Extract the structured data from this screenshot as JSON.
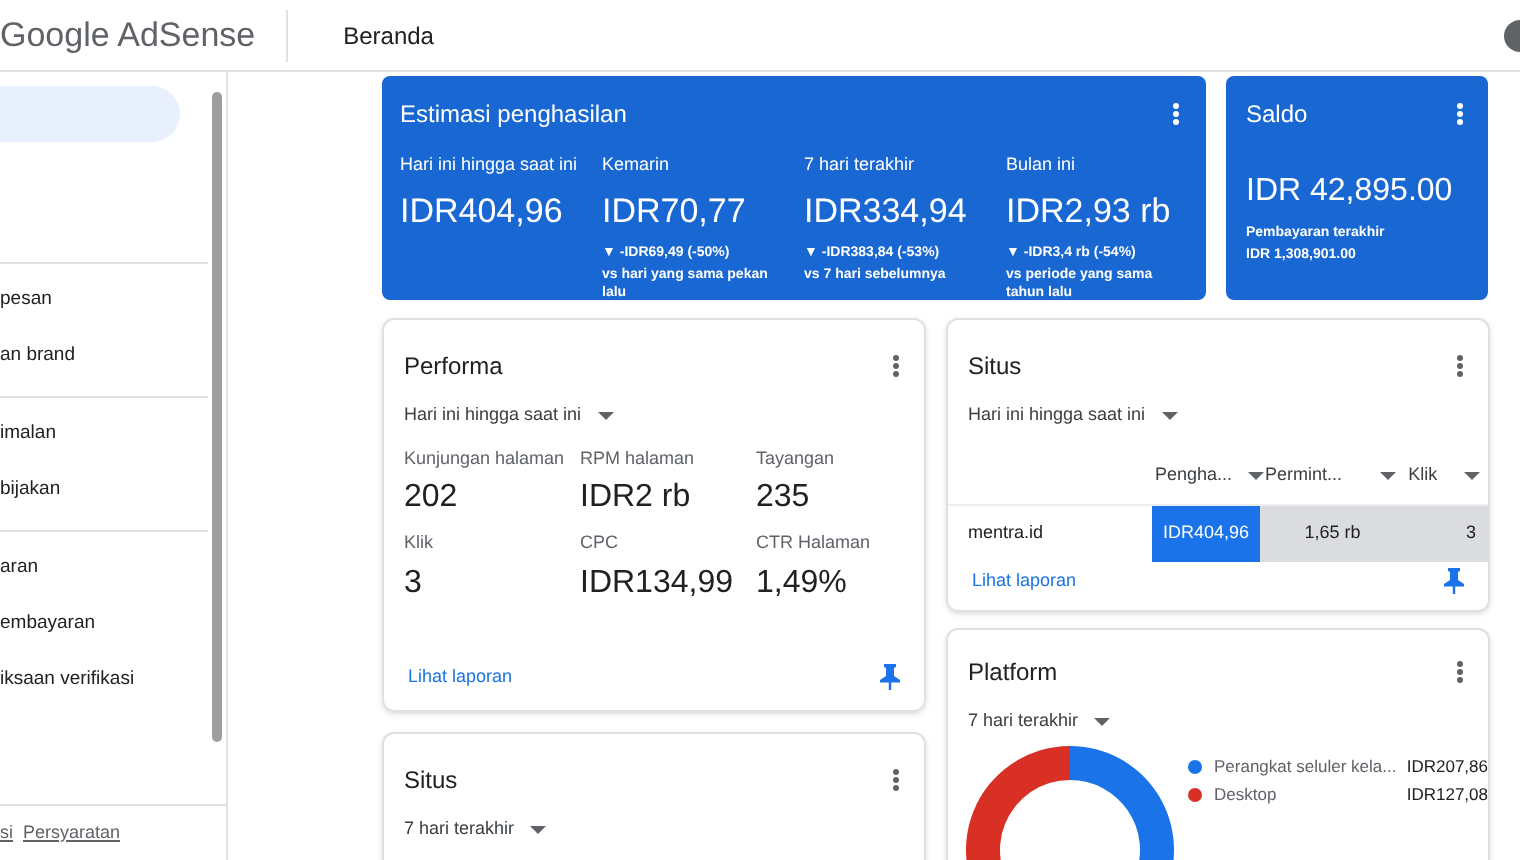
{
  "header": {
    "logo": "Google AdSense",
    "page_title": "Beranda"
  },
  "sidebar": {
    "groups": [
      {
        "items": [
          {
            "label": "pesan"
          },
          {
            "label": "an brand"
          }
        ]
      },
      {
        "items": [
          {
            "label": "imalan"
          },
          {
            "label": "bijakan"
          }
        ]
      },
      {
        "items": [
          {
            "label": "aran"
          },
          {
            "label": "embayaran"
          },
          {
            "label": "iksaan verifikasi"
          }
        ]
      }
    ],
    "footer_links": [
      "si",
      "Persyaratan"
    ]
  },
  "earnings": {
    "title": "Estimasi penghasilan",
    "metrics": [
      {
        "label": "Hari ini hingga saat ini",
        "value": "IDR404,96"
      },
      {
        "label": "Kemarin",
        "value": "IDR70,77",
        "change": "▼ -IDR69,49 (-50%)",
        "comparison": "vs hari yang sama pekan lalu"
      },
      {
        "label": "7 hari terakhir",
        "value": "IDR334,94",
        "change": "▼ -IDR383,84 (-53%)",
        "comparison": "vs 7 hari sebelumnya"
      },
      {
        "label": "Bulan ini",
        "value": "IDR2,93 rb",
        "change": "▼ -IDR3,4 rb (-54%)",
        "comparison": "vs periode yang sama tahun lalu"
      }
    ]
  },
  "balance": {
    "title": "Saldo",
    "value": "IDR 42,895.00",
    "last_payment_label": "Pembayaran terakhir",
    "last_payment_value": "IDR 1,308,901.00"
  },
  "performance": {
    "title": "Performa",
    "period": "Hari ini hingga saat ini",
    "metrics": [
      {
        "label": "Kunjungan halaman",
        "value": "202"
      },
      {
        "label": "RPM halaman",
        "value": "IDR2 rb"
      },
      {
        "label": "Tayangan",
        "value": "235"
      },
      {
        "label": "Klik",
        "value": "3"
      },
      {
        "label": "CPC",
        "value": "IDR134,99"
      },
      {
        "label": "CTR Halaman",
        "value": "1,49%"
      }
    ],
    "link": "Lihat laporan"
  },
  "sites_left": {
    "title": "Situs",
    "period": "7 hari terakhir"
  },
  "sites": {
    "title": "Situs",
    "period": "Hari ini hingga saat ini",
    "columns": [
      "Pengha...",
      "Permint...",
      "Klik"
    ],
    "rows": [
      {
        "site": "mentra.id",
        "cells": [
          "IDR404,96",
          "1,65 rb",
          "3"
        ]
      }
    ],
    "link": "Lihat laporan"
  },
  "platform": {
    "title": "Platform",
    "period": "7 hari terakhir",
    "chart_data": {
      "type": "donut",
      "categories": [
        "Perangkat seluler kela...",
        "Desktop"
      ],
      "values": [
        62.06,
        37.94
      ],
      "colors": [
        "#1a73e8",
        "#d93025"
      ],
      "value_labels": [
        "IDR207,86",
        "IDR127,08"
      ]
    }
  }
}
